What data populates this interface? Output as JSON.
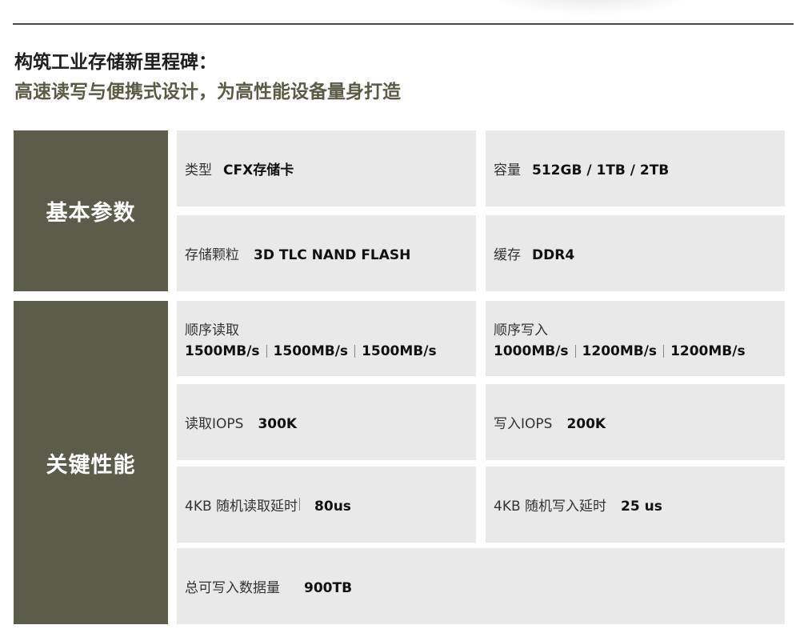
{
  "header": {
    "title_line1": "构筑工业存储新里程碑：",
    "title_line2": "高速读写与便携式设计，为高性能设备量身打造"
  },
  "sections": {
    "basic": {
      "label": "基本参数",
      "type": {
        "label": "类型",
        "value": "CFX存储卡"
      },
      "capacity": {
        "label": "容量",
        "value": "512GB / 1TB / 2TB"
      },
      "flash": {
        "label": "存储颗粒",
        "value": "3D TLC NAND FLASH"
      },
      "cache": {
        "label": "缓存",
        "value": "DDR4"
      }
    },
    "performance": {
      "label": "关键性能",
      "seq_read": {
        "label": "顺序读取",
        "values": [
          "1500MB/s",
          "1500MB/s",
          "1500MB/s"
        ]
      },
      "seq_write": {
        "label": "顺序写入",
        "values": [
          "1000MB/s",
          "1200MB/s",
          "1200MB/s"
        ]
      },
      "read_iops": {
        "label": "读取IOPS",
        "value": "300K"
      },
      "write_iops": {
        "label": "写入IOPS",
        "value": "200K"
      },
      "read_latency": {
        "label": "4KB 随机读取延时",
        "value": "80us"
      },
      "write_latency": {
        "label": "4KB 随机写入延时",
        "value": "25 us"
      },
      "tbw": {
        "label": "总可写入数据量",
        "value": "900TB"
      }
    }
  },
  "colors": {
    "section_bg": "#5c5c4b",
    "cell_bg": "#e9e9e9",
    "subtitle": "#5b5a47"
  }
}
